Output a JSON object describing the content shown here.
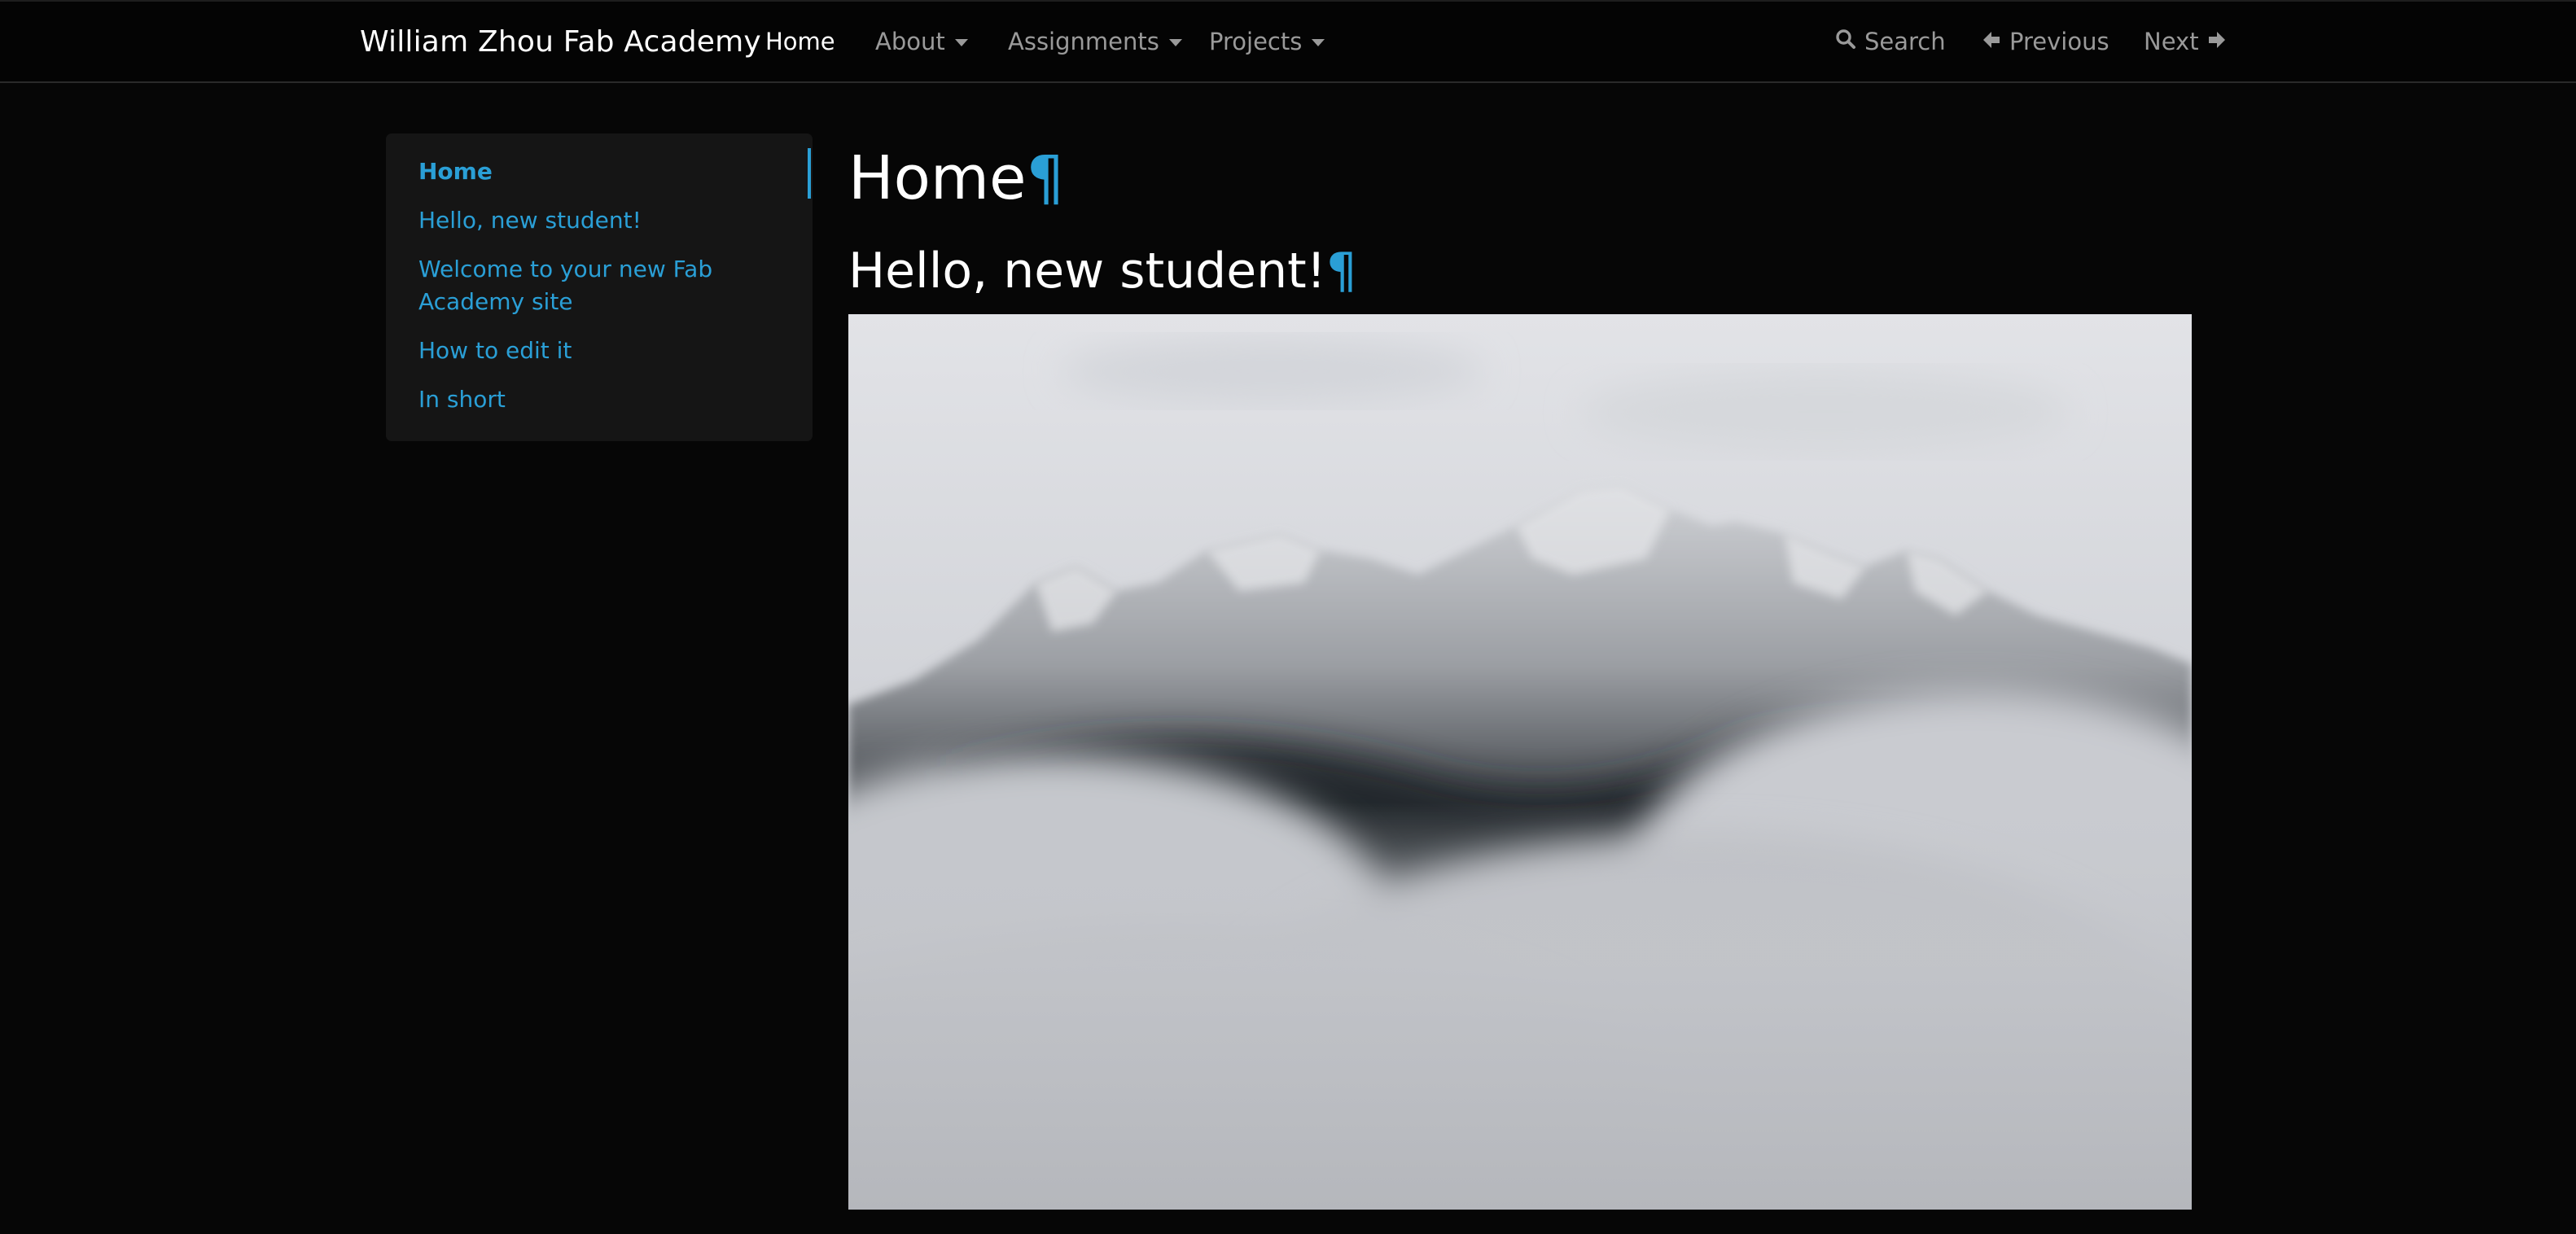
{
  "navbar": {
    "brand": "William Zhou Fab Academy",
    "items": [
      {
        "label": "Home",
        "active": true,
        "dropdown": false
      },
      {
        "label": "About",
        "active": false,
        "dropdown": true
      },
      {
        "label": "Assignments",
        "active": false,
        "dropdown": true
      },
      {
        "label": "Projects",
        "active": false,
        "dropdown": true
      }
    ],
    "search_label": "Search",
    "search_icon": "search-icon",
    "previous_label": "Previous",
    "previous_icon": "arrow-left-icon",
    "next_label": "Next",
    "next_icon": "arrow-right-icon"
  },
  "toc": {
    "items": [
      {
        "label": "Home",
        "active": true
      },
      {
        "label": "Hello, new student!",
        "active": false
      },
      {
        "label": "Welcome to your new Fab",
        "active": false
      },
      {
        "label": "Academy site",
        "active": false
      },
      {
        "label": "How to edit it",
        "active": false
      },
      {
        "label": "In short",
        "active": false
      }
    ]
  },
  "content": {
    "title": "Home",
    "subtitle": "Hello, new student!",
    "anchor_symbol": "¶"
  },
  "colors": {
    "accent": "#2a9fd6",
    "background": "#060606",
    "navbar": "#040404",
    "sidebar": "#151515"
  }
}
